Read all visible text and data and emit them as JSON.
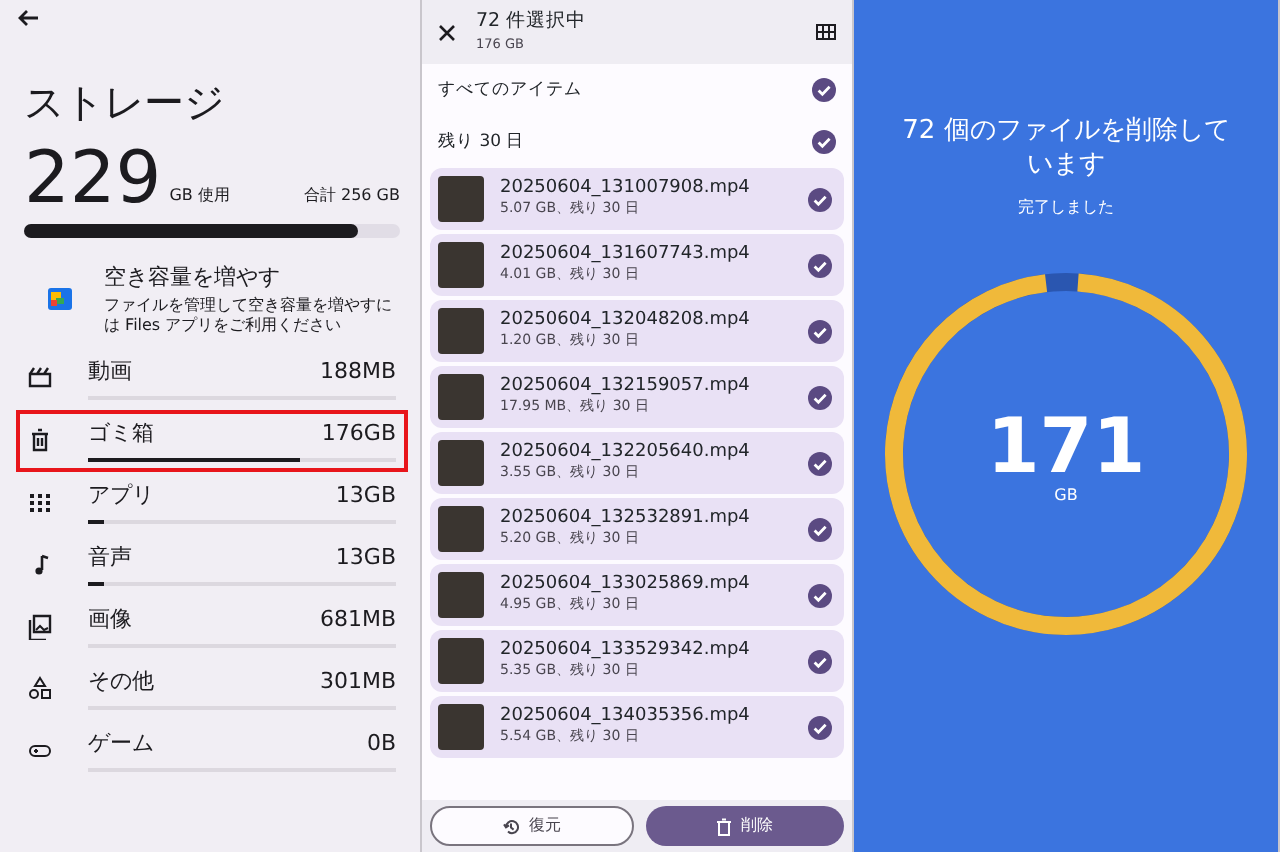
{
  "storage_panel": {
    "title": "ストレージ",
    "used_value": "229",
    "used_unit": "GB 使用",
    "total": "合計 256 GB",
    "level": 0.89,
    "promo": {
      "title": "空き容量を増やす",
      "description": "ファイルを管理して空き容量を増やすには Files アプリをご利用ください"
    },
    "categories": [
      {
        "kind": "video",
        "name": "動画",
        "size": "188MB",
        "level": 0.0,
        "highlighted": false
      },
      {
        "kind": "trash",
        "name": "ゴミ箱",
        "size": "176GB",
        "level": 0.69,
        "highlighted": true
      },
      {
        "kind": "apps",
        "name": "アプリ",
        "size": "13GB",
        "level": 0.05,
        "highlighted": false
      },
      {
        "kind": "audio",
        "name": "音声",
        "size": "13GB",
        "level": 0.05,
        "highlighted": false
      },
      {
        "kind": "image",
        "name": "画像",
        "size": "681MB",
        "level": 0.0,
        "highlighted": false
      },
      {
        "kind": "other",
        "name": "その他",
        "size": "301MB",
        "level": 0.0,
        "highlighted": false
      },
      {
        "kind": "games",
        "name": "ゲーム",
        "size": "0B",
        "level": 0.0,
        "highlighted": false
      }
    ]
  },
  "trash_panel": {
    "header": {
      "title": "72 件選択中",
      "subtitle": "176 GB"
    },
    "groups": [
      {
        "label": "すべてのアイテム",
        "selected": true
      },
      {
        "label": "残り 30 日",
        "selected": true
      }
    ],
    "files": [
      {
        "name": "20250604_131007908.mp4",
        "detail": "5.07 GB、残り 30 日",
        "selected": true
      },
      {
        "name": "20250604_131607743.mp4",
        "detail": "4.01 GB、残り 30 日",
        "selected": true
      },
      {
        "name": "20250604_132048208.mp4",
        "detail": "1.20 GB、残り 30 日",
        "selected": true
      },
      {
        "name": "20250604_132159057.mp4",
        "detail": "17.95 MB、残り 30 日",
        "selected": true
      },
      {
        "name": "20250604_132205640.mp4",
        "detail": "3.55 GB、残り 30 日",
        "selected": true
      },
      {
        "name": "20250604_132532891.mp4",
        "detail": "5.20 GB、残り 30 日",
        "selected": true
      },
      {
        "name": "20250604_133025869.mp4",
        "detail": "4.95 GB、残り 30 日",
        "selected": true
      },
      {
        "name": "20250604_133529342.mp4",
        "detail": "5.35 GB、残り 30 日",
        "selected": true
      },
      {
        "name": "20250604_134035356.mp4",
        "detail": "5.54 GB、残り 30 日",
        "selected": true
      }
    ],
    "buttons": [
      {
        "kind": "restore",
        "label": "復元"
      },
      {
        "kind": "delete",
        "label": "削除"
      }
    ]
  },
  "progress_panel": {
    "title": "72 個のファイルを削除しています",
    "status": "完了しました",
    "value": "171",
    "unit": "GB",
    "level": 0.97
  }
}
